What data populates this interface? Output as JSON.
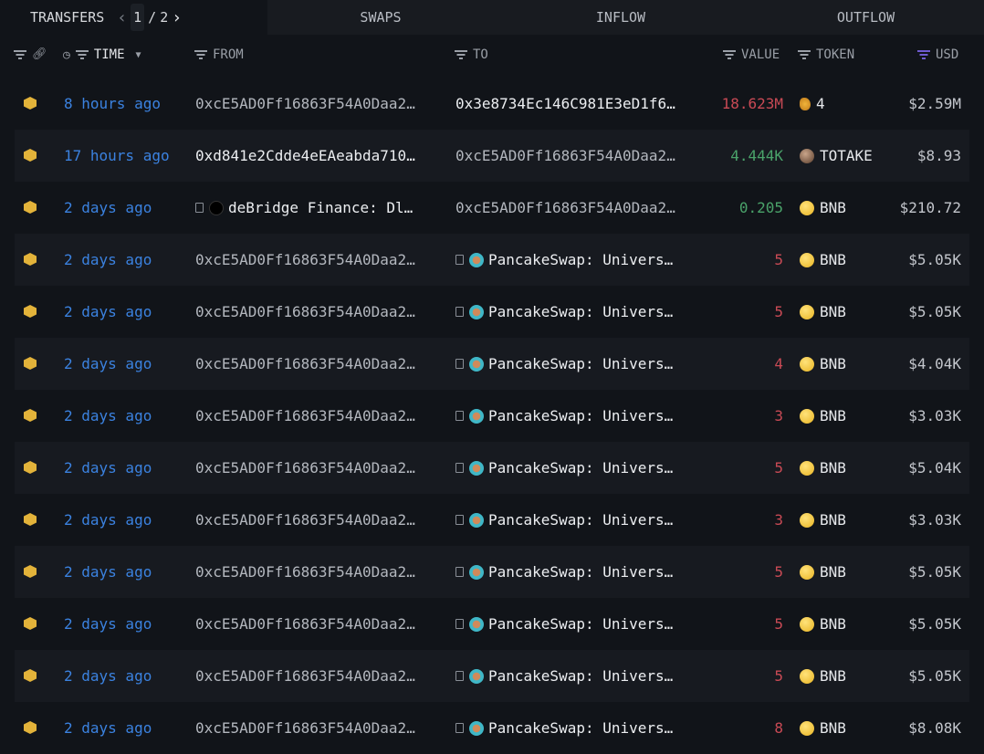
{
  "tabs": {
    "transfers": "TRANSFERS",
    "page_current": "1",
    "page_sep": "/",
    "page_total": "2",
    "swaps": "SWAPS",
    "inflow": "INFLOW",
    "outflow": "OUTFLOW"
  },
  "headers": {
    "time": "TIME",
    "from": "FROM",
    "to": "TO",
    "value": "VALUE",
    "token": "TOKEN",
    "usd": "USD"
  },
  "rows": [
    {
      "time": "8 hours ago",
      "from": "0xcE5AD0Ff16863F54A0Daa2…",
      "from_bright": false,
      "to": "0x3e8734Ec146C981E3eD1f6…",
      "to_bright": true,
      "value": "18.623M",
      "dir": "neg",
      "token": "4",
      "token_icon": "hand",
      "usd": "$2.59M"
    },
    {
      "time": "17 hours ago",
      "from": "0xd841e2Cdde4eEAeabda710…",
      "from_bright": true,
      "to": "0xcE5AD0Ff16863F54A0Daa2…",
      "to_bright": false,
      "value": "4.444K",
      "dir": "pos",
      "token": "TOTAKE",
      "token_icon": "totake",
      "usd": "$8.93"
    },
    {
      "time": "2 days ago",
      "from": "deBridge Finance: Dl…",
      "from_entity": true,
      "from_bright": true,
      "to": "0xcE5AD0Ff16863F54A0Daa2…",
      "to_bright": false,
      "value": "0.205",
      "dir": "pos",
      "token": "BNB",
      "token_icon": "bnb",
      "usd": "$210.72"
    },
    {
      "time": "2 days ago",
      "from": "0xcE5AD0Ff16863F54A0Daa2…",
      "to": "PancakeSwap: Univers…",
      "to_entity": true,
      "value": "5",
      "dir": "neg",
      "token": "BNB",
      "token_icon": "bnb",
      "usd": "$5.05K"
    },
    {
      "time": "2 days ago",
      "from": "0xcE5AD0Ff16863F54A0Daa2…",
      "to": "PancakeSwap: Univers…",
      "to_entity": true,
      "value": "5",
      "dir": "neg",
      "token": "BNB",
      "token_icon": "bnb",
      "usd": "$5.05K"
    },
    {
      "time": "2 days ago",
      "from": "0xcE5AD0Ff16863F54A0Daa2…",
      "to": "PancakeSwap: Univers…",
      "to_entity": true,
      "value": "4",
      "dir": "neg",
      "token": "BNB",
      "token_icon": "bnb",
      "usd": "$4.04K"
    },
    {
      "time": "2 days ago",
      "from": "0xcE5AD0Ff16863F54A0Daa2…",
      "to": "PancakeSwap: Univers…",
      "to_entity": true,
      "value": "3",
      "dir": "neg",
      "token": "BNB",
      "token_icon": "bnb",
      "usd": "$3.03K"
    },
    {
      "time": "2 days ago",
      "from": "0xcE5AD0Ff16863F54A0Daa2…",
      "to": "PancakeSwap: Univers…",
      "to_entity": true,
      "value": "5",
      "dir": "neg",
      "token": "BNB",
      "token_icon": "bnb",
      "usd": "$5.04K"
    },
    {
      "time": "2 days ago",
      "from": "0xcE5AD0Ff16863F54A0Daa2…",
      "to": "PancakeSwap: Univers…",
      "to_entity": true,
      "value": "3",
      "dir": "neg",
      "token": "BNB",
      "token_icon": "bnb",
      "usd": "$3.03K"
    },
    {
      "time": "2 days ago",
      "from": "0xcE5AD0Ff16863F54A0Daa2…",
      "to": "PancakeSwap: Univers…",
      "to_entity": true,
      "value": "5",
      "dir": "neg",
      "token": "BNB",
      "token_icon": "bnb",
      "usd": "$5.05K"
    },
    {
      "time": "2 days ago",
      "from": "0xcE5AD0Ff16863F54A0Daa2…",
      "to": "PancakeSwap: Univers…",
      "to_entity": true,
      "value": "5",
      "dir": "neg",
      "token": "BNB",
      "token_icon": "bnb",
      "usd": "$5.05K"
    },
    {
      "time": "2 days ago",
      "from": "0xcE5AD0Ff16863F54A0Daa2…",
      "to": "PancakeSwap: Univers…",
      "to_entity": true,
      "value": "5",
      "dir": "neg",
      "token": "BNB",
      "token_icon": "bnb",
      "usd": "$5.05K"
    },
    {
      "time": "2 days ago",
      "from": "0xcE5AD0Ff16863F54A0Daa2…",
      "to": "PancakeSwap: Univers…",
      "to_entity": true,
      "value": "8",
      "dir": "neg",
      "token": "BNB",
      "token_icon": "bnb",
      "usd": "$8.08K"
    }
  ]
}
